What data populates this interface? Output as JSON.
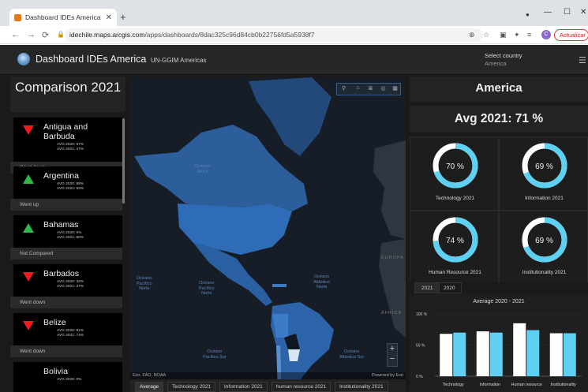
{
  "browser": {
    "tab_title": "Dashboard IDEs America",
    "url_host": "idechile.maps.arcgis.com",
    "url_path": "/apps/dashboards/8dac325c96d84cb0b22756fd5a5938f7",
    "profile_initial": "C",
    "update_label": "Actualizar"
  },
  "header": {
    "title": "Dashboard IDEs America",
    "subtitle": "UN-GGIM Americas",
    "select_label": "Select country",
    "select_value": "America"
  },
  "left": {
    "title": "Comparison 2021",
    "items": [
      {
        "name": "Antigua and Barbuda",
        "avg2020": "AVG 2020: 57%",
        "avg2021": "AVG 2021: 47%",
        "status": "Went down",
        "trend": "down"
      },
      {
        "name": "Argentina",
        "avg2020": "AVG 2020: 88%",
        "avg2021": "AVG 2021: 93%",
        "status": "Went up",
        "trend": "up"
      },
      {
        "name": "Bahamas",
        "avg2020": "AVG 2020: 0%",
        "avg2021": "AVG 2021: 60%",
        "status": "Not Compared",
        "trend": "up"
      },
      {
        "name": "Barbados",
        "avg2020": "AVG 2020: 32%",
        "avg2021": "AVG 2021: 27%",
        "status": "Went down",
        "trend": "down"
      },
      {
        "name": "Belize",
        "avg2020": "AVG 2020: 81%",
        "avg2021": "AVG 2021: 74%",
        "status": "Went down",
        "trend": "down"
      },
      {
        "name": "Bolivia",
        "avg2020": "AVG 2020: 0%",
        "avg2021": "",
        "status": "",
        "trend": "none"
      }
    ]
  },
  "map": {
    "oceans": {
      "artico": "Océano\nÁrtico",
      "pacifico_norte_1": "Océano\nPacífico\nNorte",
      "pacifico_norte_2": "Océano\nPacífico\nNorte",
      "atlantico_norte": "Océano\nAtlántico\nNorte",
      "pacifico_sur": "Océano\nPacífico Sur",
      "atlantico_sur": "Océano\nAtlántico Sur",
      "europa": "EUROPA",
      "africa": "ÁFRICA"
    },
    "attribution_left": "Esri, FAO, NOAA",
    "attribution_right": "Powered by Esri",
    "tabs": [
      "Average",
      "Technology 2021",
      "Information 2021",
      "human resource 2021",
      "Institutionality 2021"
    ]
  },
  "right": {
    "title": "America",
    "avg": "Avg 2021: 71 %",
    "gauges": [
      {
        "label": "Technology 2021",
        "display": "70 %",
        "value": 70
      },
      {
        "label": "Information 2021",
        "display": "69 %",
        "value": 69
      },
      {
        "label": "Human Resource 2021",
        "display": "74 %",
        "value": 74
      },
      {
        "label": "Institutionality 2021",
        "display": "69 %",
        "value": 69
      }
    ],
    "year_tabs": [
      "2021",
      "2020"
    ]
  },
  "chart_data": {
    "type": "bar",
    "title": "Average 2020 - 2021",
    "categories": [
      "Technology",
      "Information",
      "Human resource",
      "Institutionality"
    ],
    "series": [
      {
        "values": [
          68,
          72,
          85,
          69
        ],
        "color": "#ffffff"
      },
      {
        "values": [
          70,
          70,
          74,
          69
        ],
        "color": "#5ed0f2"
      }
    ],
    "ylim": [
      0,
      100
    ],
    "yticks": [
      "100 %",
      "50 %",
      "0 %"
    ]
  }
}
